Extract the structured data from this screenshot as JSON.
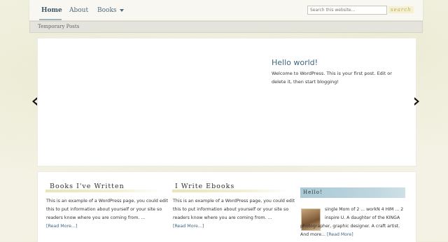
{
  "nav": {
    "home": "Home",
    "about": "About",
    "books": "Books"
  },
  "search": {
    "placeholder": "Search this website...",
    "button": "search"
  },
  "subnav": {
    "label": "Temporary Posts"
  },
  "slider": {
    "title": "Hello world!",
    "text": "Welcome to WordPress. This is your first post. Edit or delete it, then start blogging!"
  },
  "columns": [
    {
      "title": "Books I've Written",
      "text": "This is an example of a WordPress page, you could edit this to put information about yourself or your site so readers know where you are coming from. ...",
      "more": "[Read More...]"
    },
    {
      "title": "I Write Ebooks",
      "text": "This is an example of a WordPress page, you could edit this to put information about yourself or your site so readers know where you are coming from. ...",
      "more": "[Read More...]"
    }
  ],
  "sidebar": {
    "heading": "Hello!",
    "bio_line1": "single Mom of 2 ... workN 4 HIM ... 2 inspire U. A daughter of the KINGA",
    "bio_line2": "photographer, graphic designer. A craft artist. And more...",
    "more": "[Read More]"
  },
  "colors": {
    "link": "#3e6780",
    "background": "#f3f2e4"
  }
}
